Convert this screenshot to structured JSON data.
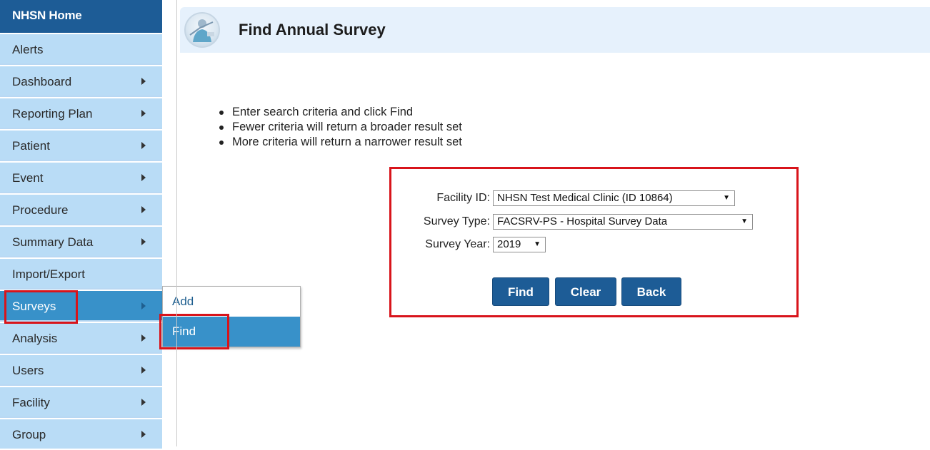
{
  "sidebar": {
    "home": "NHSN Home",
    "items": [
      {
        "label": "Alerts"
      },
      {
        "label": "Dashboard"
      },
      {
        "label": "Reporting Plan"
      },
      {
        "label": "Patient"
      },
      {
        "label": "Event"
      },
      {
        "label": "Procedure"
      },
      {
        "label": "Summary Data"
      },
      {
        "label": "Import/Export"
      },
      {
        "label": "Surveys"
      },
      {
        "label": "Analysis"
      },
      {
        "label": "Users"
      },
      {
        "label": "Facility"
      },
      {
        "label": "Group"
      }
    ]
  },
  "submenu": {
    "add": "Add",
    "find": "Find"
  },
  "header": {
    "title": "Find Annual Survey",
    "icon": "nurse-avatar-icon"
  },
  "instructions": [
    "Enter search criteria and click Find",
    "Fewer criteria will return a broader result set",
    "More criteria will return a narrower result set"
  ],
  "form": {
    "facility_label": "Facility ID:",
    "facility_value": "NHSN Test Medical Clinic (ID 10864)",
    "survey_type_label": "Survey Type:",
    "survey_type_value": "FACSRV-PS - Hospital Survey Data",
    "survey_year_label": "Survey Year:",
    "survey_year_value": "2019"
  },
  "buttons": {
    "find": "Find",
    "clear": "Clear",
    "back": "Back"
  },
  "colors": {
    "brand": "#1d5c96",
    "nav_bg": "#b9dcf6",
    "active": "#3891c9",
    "highlight": "#d8141b",
    "header_bg": "#e6f1fc"
  }
}
